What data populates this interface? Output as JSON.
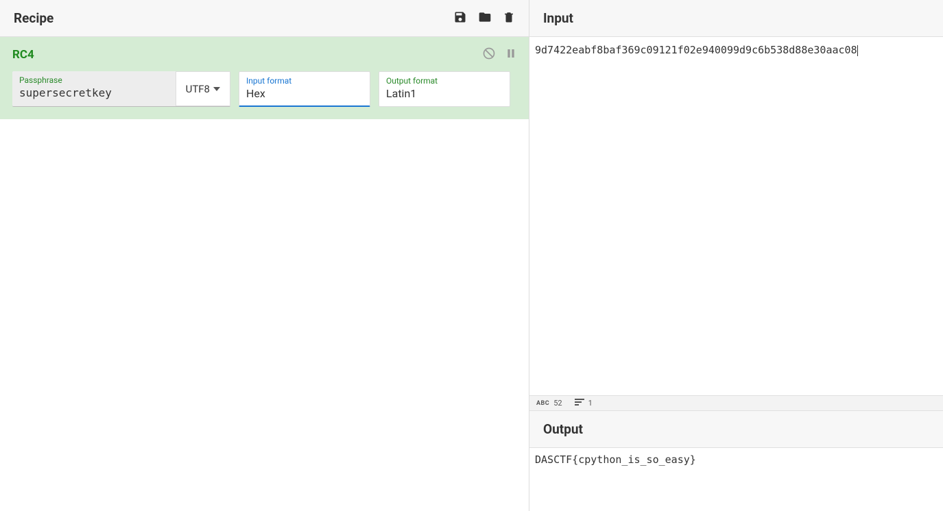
{
  "recipe": {
    "title": "Recipe",
    "operation": {
      "name": "RC4",
      "params": {
        "passphrase": {
          "label": "Passphrase",
          "value": "supersecretkey",
          "encoding": "UTF8"
        },
        "input_format": {
          "label": "Input format",
          "value": "Hex"
        },
        "output_format": {
          "label": "Output format",
          "value": "Latin1"
        }
      }
    }
  },
  "input": {
    "title": "Input",
    "value": "9d7422eabf8baf369c09121f02e940099d9c6b538d88e30aac08",
    "stats": {
      "chars_label": "abc",
      "chars": "52",
      "lines": "1"
    }
  },
  "output": {
    "title": "Output",
    "value": "DASCTF{cpython_is_so_easy}"
  }
}
